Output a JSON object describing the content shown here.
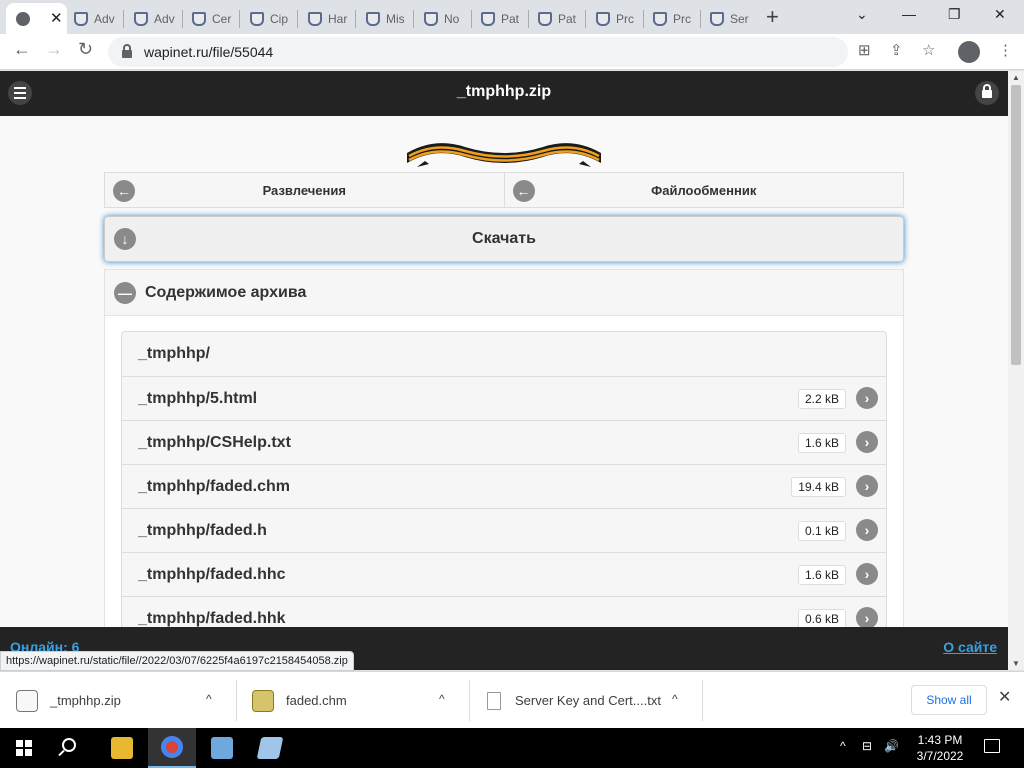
{
  "browser": {
    "active_tab": {
      "label": "",
      "close_glyph": "✕"
    },
    "tabs": [
      {
        "label": "Adv"
      },
      {
        "label": "Adv"
      },
      {
        "label": "Cer"
      },
      {
        "label": "Cip"
      },
      {
        "label": "Har"
      },
      {
        "label": "Mis"
      },
      {
        "label": "No"
      },
      {
        "label": "Pat"
      },
      {
        "label": "Pat"
      },
      {
        "label": "Prc"
      },
      {
        "label": "Prc"
      },
      {
        "label": "Ser"
      }
    ],
    "new_tab_glyph": "+",
    "window_controls": {
      "tab_search": "⌄",
      "minimize": "—",
      "restore": "❐",
      "close": "✕"
    },
    "nav": {
      "back": "←",
      "forward": "→",
      "reload": "↻"
    },
    "url": "wapinet.ru/file/55044",
    "toolbar_icons": {
      "translate": "⊞",
      "share": "⇪",
      "bookmark": "☆",
      "menu": "⋮"
    },
    "status_url": "https://wapinet.ru/static/file//2022/03/07/6225f4a6197c2158454058.zip"
  },
  "page": {
    "title": "_tmphhp.zip",
    "nav_links": [
      {
        "label": "Развлечения",
        "icon": "arrow-left-icon",
        "glyph": "←"
      },
      {
        "label": "Файлообменник",
        "icon": "arrow-left-icon",
        "glyph": "←"
      }
    ],
    "download": {
      "label": "Скачать",
      "glyph": "↓"
    },
    "archive": {
      "heading": "Содержимое архива",
      "collapse_glyph": "—",
      "files": [
        {
          "name": "_tmphhp/",
          "size": ""
        },
        {
          "name": "_tmphhp/5.html",
          "size": "2.2 kB"
        },
        {
          "name": "_tmphhp/CSHelp.txt",
          "size": "1.6 kB"
        },
        {
          "name": "_tmphhp/faded.chm",
          "size": "19.4 kB"
        },
        {
          "name": "_tmphhp/faded.h",
          "size": "0.1 kB"
        },
        {
          "name": "_tmphhp/faded.hhc",
          "size": "1.6 kB"
        },
        {
          "name": "_tmphhp/faded.hhk",
          "size": "0.6 kB"
        }
      ],
      "row_go_glyph": "›"
    },
    "footer": {
      "online": "Онлайн: 6",
      "about": "О сайте"
    }
  },
  "downloads": {
    "items": [
      {
        "name": "_tmphhp.zip"
      },
      {
        "name": "faded.chm"
      },
      {
        "name": "Server Key and Cert....txt"
      }
    ],
    "chevron": "^",
    "show_all": "Show all",
    "close_glyph": "✕"
  },
  "taskbar": {
    "time": "1:43 PM",
    "date": "3/7/2022",
    "tray": {
      "chevron": "^",
      "network": "⊟",
      "volume": "🔊"
    }
  },
  "colors": {
    "site_header": "#232323",
    "link": "#3aa0e0",
    "accent_glow": "#3388cc",
    "chrome_blue": "#1a73e8"
  }
}
